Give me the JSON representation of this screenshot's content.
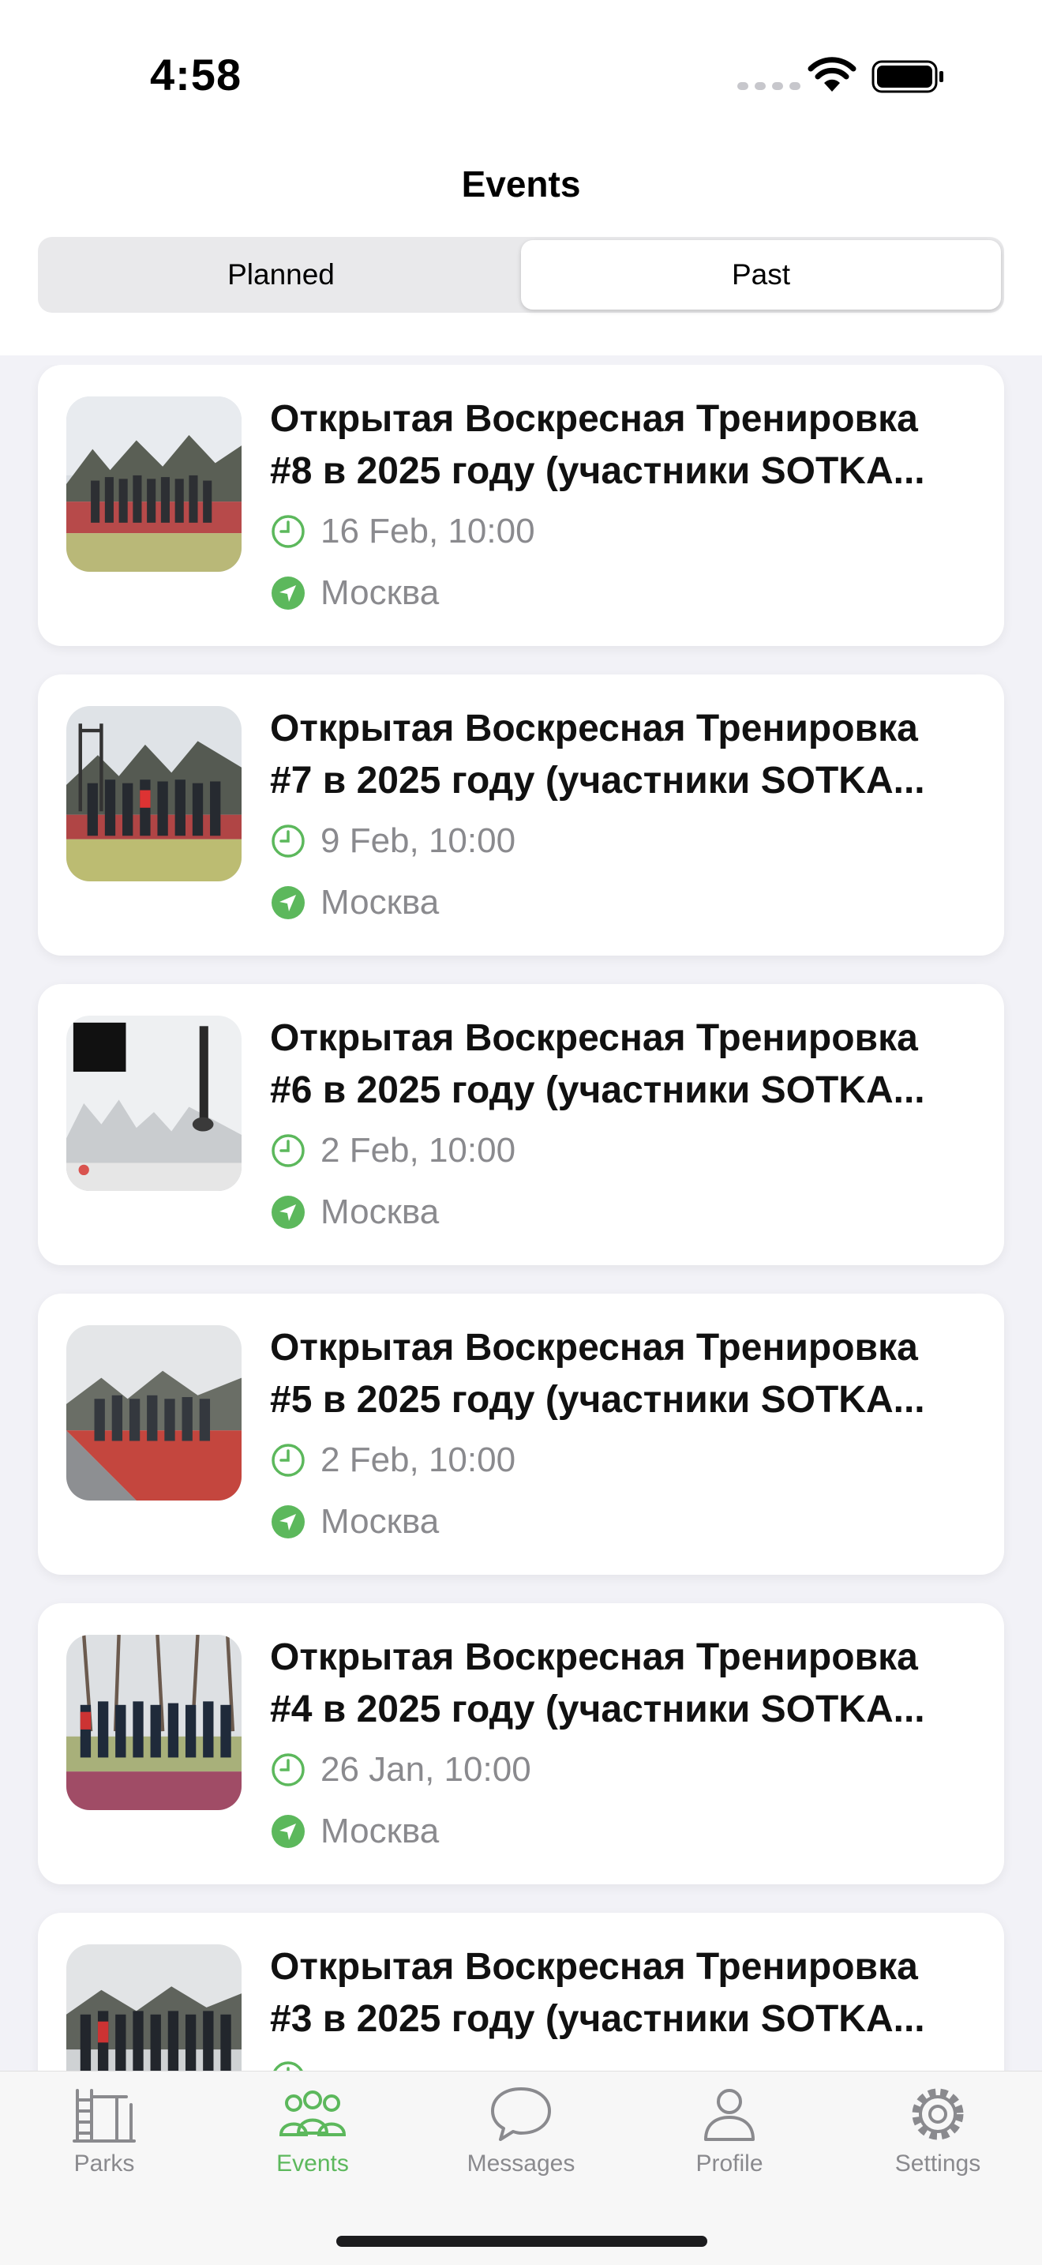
{
  "status_bar": {
    "time": "4:58"
  },
  "header": {
    "title": "Events"
  },
  "segments": [
    {
      "label": "Planned",
      "selected": false
    },
    {
      "label": "Past",
      "selected": true
    }
  ],
  "events": [
    {
      "title_line1": "Открытая Воскресная Тренировка",
      "title_line2": "#8 в 2025 году (участники SOTKA...",
      "date": "16 Feb, 10:00",
      "place": "Москва"
    },
    {
      "title_line1": "Открытая Воскресная Тренировка",
      "title_line2": "#7 в 2025 году (участники SOTKA...",
      "date": "9 Feb, 10:00",
      "place": "Москва"
    },
    {
      "title_line1": "Открытая Воскресная Тренировка",
      "title_line2": "#6 в 2025 году (участники SOTKA...",
      "date": "2 Feb, 10:00",
      "place": "Москва"
    },
    {
      "title_line1": "Открытая Воскресная Тренировка",
      "title_line2": "#5 в 2025 году (участники SOTKA...",
      "date": "2 Feb, 10:00",
      "place": "Москва"
    },
    {
      "title_line1": "Открытая Воскресная Тренировка",
      "title_line2": "#4 в 2025 году (участники SOTKA...",
      "date": "26 Jan, 10:00",
      "place": "Москва"
    },
    {
      "title_line1": "Открытая Воскресная Тренировка",
      "title_line2": "#3 в 2025 году (участники SOTKA...",
      "date": "",
      "place": ""
    }
  ],
  "tab_bar": {
    "items": [
      {
        "label": "Parks",
        "icon": "parks-icon",
        "active": false
      },
      {
        "label": "Events",
        "icon": "events-icon",
        "active": true
      },
      {
        "label": "Messages",
        "icon": "messages-icon",
        "active": false
      },
      {
        "label": "Profile",
        "icon": "profile-icon",
        "active": false
      },
      {
        "label": "Settings",
        "icon": "settings-icon",
        "active": false
      }
    ]
  },
  "colors": {
    "accent": "#5cb85c",
    "secondary_text": "#8a8a8e",
    "background": "#f2f2f7"
  }
}
